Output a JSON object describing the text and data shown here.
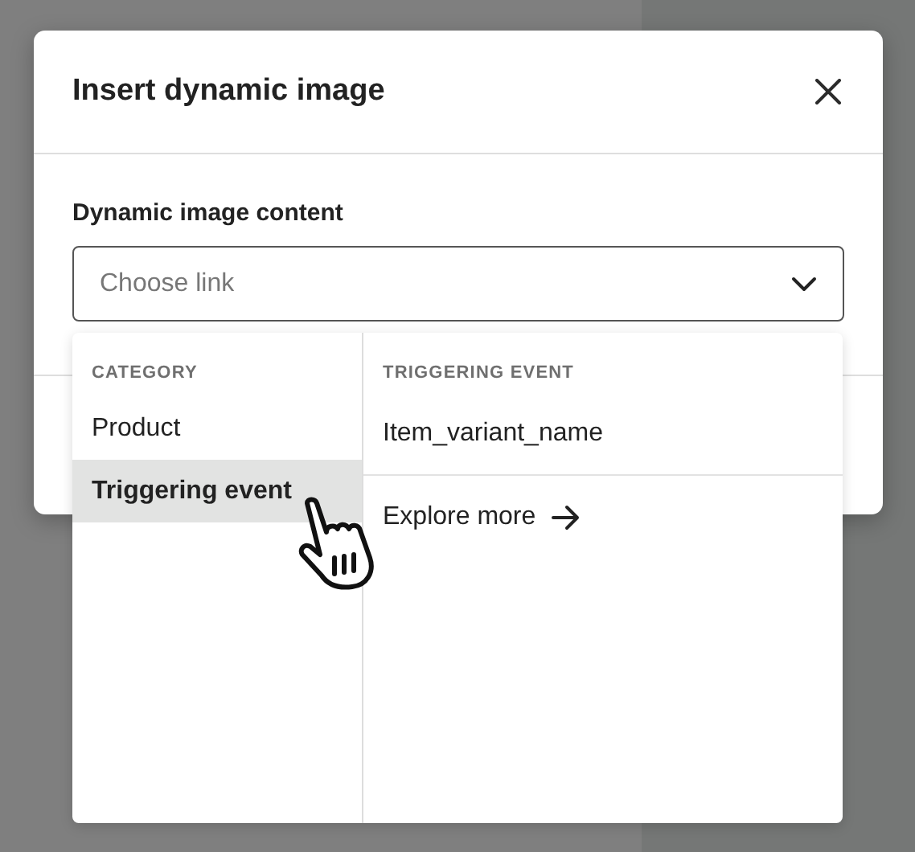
{
  "dialog": {
    "title": "Insert dynamic image"
  },
  "field": {
    "label": "Dynamic image content",
    "placeholder": "Choose link"
  },
  "dropdown": {
    "categories_heading": "CATEGORY",
    "categories": [
      {
        "label": "Product",
        "selected": false
      },
      {
        "label": "Triggering event",
        "selected": true
      }
    ],
    "options_heading": "TRIGGERING EVENT",
    "options": [
      "Item_variant_name"
    ],
    "explore_link": "Explore more"
  }
}
